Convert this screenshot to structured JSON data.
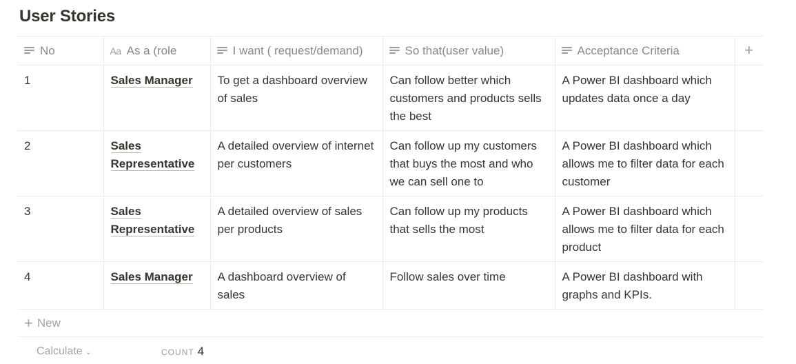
{
  "page": {
    "title": "User Stories"
  },
  "table": {
    "columns": [
      {
        "label": "No",
        "icon": "text-lines-icon"
      },
      {
        "label": "As a (role",
        "icon": "title-aa-icon"
      },
      {
        "label": "I want ( request/demand)",
        "icon": "text-lines-icon"
      },
      {
        "label": "So that(user value)",
        "icon": "text-lines-icon"
      },
      {
        "label": "Acceptance Criteria",
        "icon": "text-lines-icon"
      }
    ],
    "add_column": "+",
    "rows": [
      {
        "no": "1",
        "role": "Sales Manager",
        "want": "To get a dashboard overview of sales",
        "so_that": "Can follow better which customers and products sells the best",
        "acceptance": "A Power BI dashboard which updates data once a day"
      },
      {
        "no": "2",
        "role": "Sales Representative",
        "want": "A detailed overview of internet per customers",
        "so_that": "Can follow up my customers that buys the most and who we can sell one to",
        "acceptance": "A Power BI dashboard which allows me to filter data for each customer"
      },
      {
        "no": "3",
        "role": "Sales Representative",
        "want": "A detailed overview of sales per products",
        "so_that": "Can follow up my products that sells the most",
        "acceptance": "A Power BI dashboard which allows me to filter data for each product"
      },
      {
        "no": "4",
        "role": "Sales Manager",
        "want": "A dashboard overview of sales",
        "so_that": "Follow sales over time",
        "acceptance": "A Power BI dashboard with graphs and KPIs."
      }
    ],
    "new_row_label": "New",
    "footer": {
      "calculate_label": "Calculate",
      "count_label": "COUNT",
      "count_value": "4"
    }
  }
}
